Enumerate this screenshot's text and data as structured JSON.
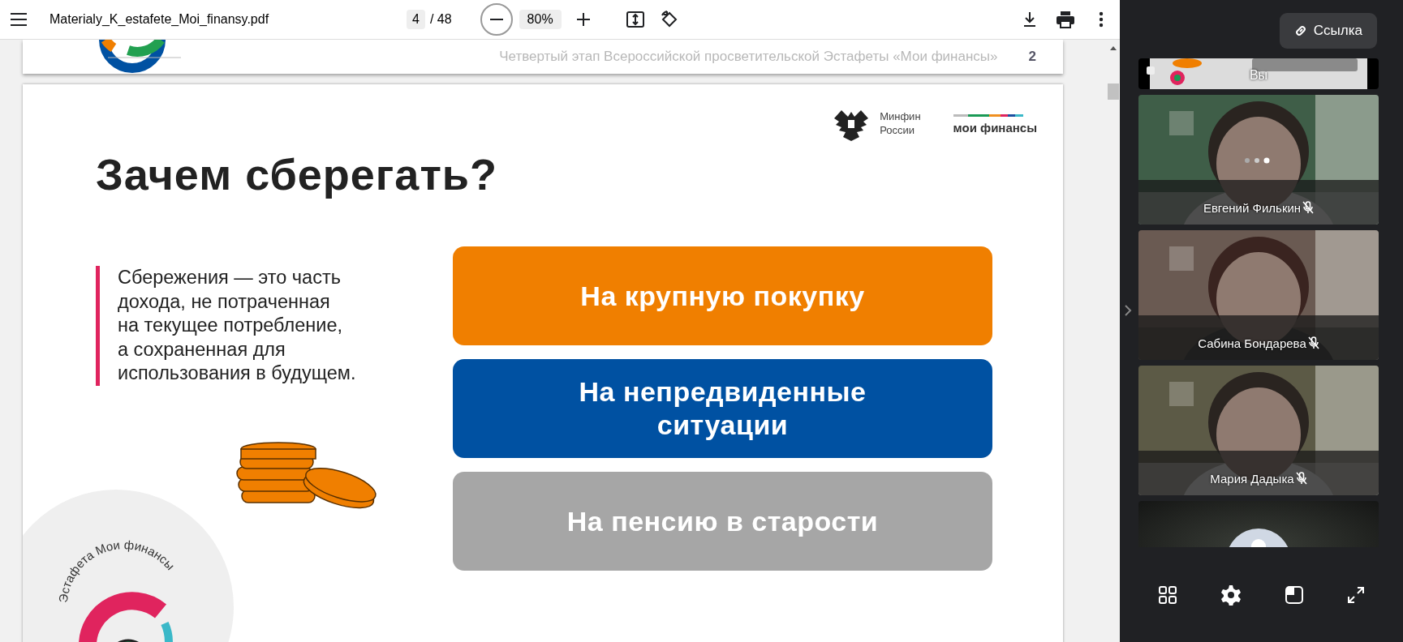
{
  "toolbar": {
    "file_name": "Materialy_K_estafete_Moi_finansy.pdf",
    "page_current": "4",
    "page_total": "/ 48",
    "zoom": "80%"
  },
  "previous_page": {
    "footer_text": "Четвертый этап Всероссийской просветительской Эстафеты «Мои финансы»",
    "page_number": "2"
  },
  "slide": {
    "title": "Зачем сберегать?",
    "ministry": "Минфин\nРоссии",
    "brand": "мои финансы",
    "definition": "Сбережения — это часть\nдохода, не потраченная\nна текущее потребление,\nа сохраненная для\nиспользования в будущем.",
    "relay_logo_text": "Эстафета Мои финансы",
    "reasons": [
      {
        "label": "На крупную покупку",
        "color": "#f07f00"
      },
      {
        "label": "На непредвиденные\nситуации",
        "color": "#0051a2"
      },
      {
        "label": "На пенсию в старости",
        "color": "#a6a6a6"
      }
    ]
  },
  "call": {
    "link_button": "Ссылка",
    "participants": [
      {
        "kind": "self",
        "name": "Вы",
        "muted": false
      },
      {
        "kind": "video",
        "name": "Евгений Филькин",
        "muted": true,
        "loading": true
      },
      {
        "kind": "video",
        "name": "Сабина Бондарева",
        "muted": true,
        "loading": false
      },
      {
        "kind": "video",
        "name": "Мария Дадыка",
        "muted": true,
        "loading": false
      },
      {
        "kind": "avatar"
      }
    ]
  }
}
